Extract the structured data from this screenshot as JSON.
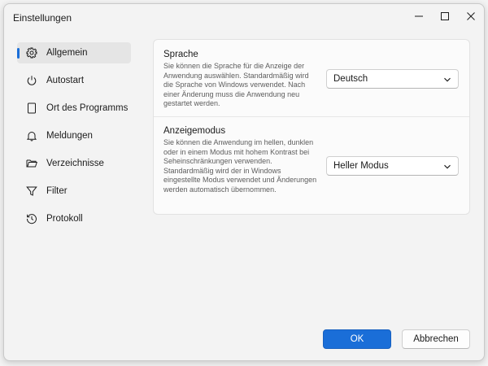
{
  "window": {
    "title": "Einstellungen",
    "controls": [
      "minimize-icon",
      "maximize-icon",
      "close-icon"
    ]
  },
  "sidebar": {
    "items": [
      {
        "label": "Allgemein",
        "icon": "gear-icon",
        "active": true
      },
      {
        "label": "Autostart",
        "icon": "power-icon",
        "active": false
      },
      {
        "label": "Ort des Programms",
        "icon": "document-icon",
        "active": false
      },
      {
        "label": "Meldungen",
        "icon": "bell-icon",
        "active": false
      },
      {
        "label": "Verzeichnisse",
        "icon": "folder-icon",
        "active": false
      },
      {
        "label": "Filter",
        "icon": "filter-icon",
        "active": false
      },
      {
        "label": "Protokoll",
        "icon": "history-icon",
        "active": false
      }
    ]
  },
  "settings": {
    "language": {
      "title": "Sprache",
      "description": "Sie können die Sprache für die Anzeige der Anwendung auswählen. Standardmäßig wird die Sprache von Windows verwendet. Nach einer Änderung muss die Anwendung neu gestartet werden.",
      "selected": "Deutsch"
    },
    "display_mode": {
      "title": "Anzeigemodus",
      "description": "Sie können die Anwendung im hellen, dunklen oder in einem Modus mit hohem Kontrast bei Seheinschränkungen verwenden. Standardmäßig wird der in Windows eingestellte Modus verwendet und Änderungen werden automatisch übernommen.",
      "selected": "Heller Modus"
    }
  },
  "footer": {
    "ok_label": "OK",
    "cancel_label": "Abbrechen"
  },
  "colors": {
    "accent": "#1a6ed8",
    "background": "#f3f3f3",
    "card": "#fbfbfb"
  }
}
